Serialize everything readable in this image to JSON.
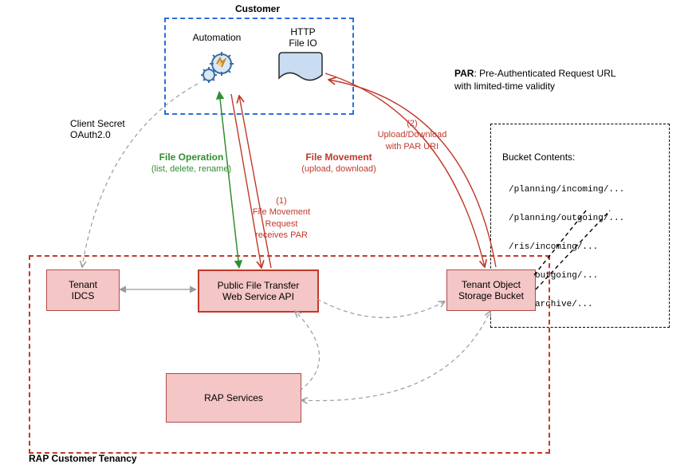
{
  "customer": {
    "title": "Customer",
    "automation_label": "Automation",
    "http_label": "HTTP\nFile IO"
  },
  "par_note": {
    "bold": "PAR",
    "rest": ": Pre-Authenticated Request URL\nwith limited-time validity"
  },
  "bucket_contents": {
    "title": "Bucket Contents:",
    "lines": [
      "/planning/incoming/...",
      "/planning/outgoing/...",
      "/ris/incoming/...",
      "/ris/outgoing/...",
      "/ris/archive/..."
    ]
  },
  "connectors": {
    "client_secret": "Client Secret\nOAuth2.0",
    "file_operation_title": "File Operation",
    "file_operation_sub": "(list, delete, rename)",
    "file_movement_title": "File Movement",
    "file_movement_sub": "(upload, download)",
    "step1": "(1)\nFile Movement\nRequest\nreceives PAR",
    "step2": "(2)\nUpload/Download\nwith PAR URI"
  },
  "boxes": {
    "tenant_idcs": "Tenant\nIDCS",
    "public_api": "Public File Transfer\nWeb Service API",
    "storage_bucket": "Tenant Object\nStorage Bucket",
    "rap_services": "RAP Services",
    "rap_tenancy": "RAP Customer Tenancy"
  },
  "chart_data": {
    "type": "diagram",
    "nodes": [
      {
        "id": "customer",
        "label": "Customer",
        "kind": "container"
      },
      {
        "id": "automation",
        "label": "Automation",
        "kind": "actor"
      },
      {
        "id": "http_file_io",
        "label": "HTTP File IO",
        "kind": "actor"
      },
      {
        "id": "tenant_idcs",
        "label": "Tenant IDCS",
        "kind": "service"
      },
      {
        "id": "public_api",
        "label": "Public File Transfer Web Service API",
        "kind": "service"
      },
      {
        "id": "storage_bucket",
        "label": "Tenant Object Storage Bucket",
        "kind": "service"
      },
      {
        "id": "rap_services",
        "label": "RAP Services",
        "kind": "service"
      },
      {
        "id": "rap_tenancy",
        "label": "RAP Customer Tenancy",
        "kind": "container"
      },
      {
        "id": "bucket_contents",
        "label": "Bucket Contents",
        "kind": "annotation"
      }
    ],
    "edges": [
      {
        "from": "automation",
        "to": "tenant_idcs",
        "label": "Client Secret OAuth2.0",
        "style": "dashed-grey",
        "bidirectional": false
      },
      {
        "from": "automation",
        "to": "public_api",
        "label": "File Operation (list, delete, rename)",
        "style": "green",
        "bidirectional": true
      },
      {
        "from": "automation",
        "to": "public_api",
        "label": "(1) File Movement Request receives PAR",
        "style": "red",
        "title": "File Movement (upload, download)",
        "bidirectional": true
      },
      {
        "from": "http_file_io",
        "to": "storage_bucket",
        "label": "(2) Upload/Download with PAR URI",
        "style": "red",
        "bidirectional": true
      },
      {
        "from": "tenant_idcs",
        "to": "public_api",
        "style": "grey",
        "bidirectional": true
      },
      {
        "from": "public_api",
        "to": "storage_bucket",
        "style": "dashed-grey",
        "bidirectional": false
      },
      {
        "from": "rap_services",
        "to": "public_api",
        "style": "dashed-grey",
        "bidirectional": false
      },
      {
        "from": "rap_services",
        "to": "storage_bucket",
        "style": "dashed-grey",
        "bidirectional": true
      },
      {
        "from": "storage_bucket",
        "to": "bucket_contents",
        "style": "dashed-black",
        "bidirectional": false
      }
    ],
    "legend": [
      {
        "text": "PAR: Pre-Authenticated Request URL with limited-time validity"
      }
    ]
  }
}
